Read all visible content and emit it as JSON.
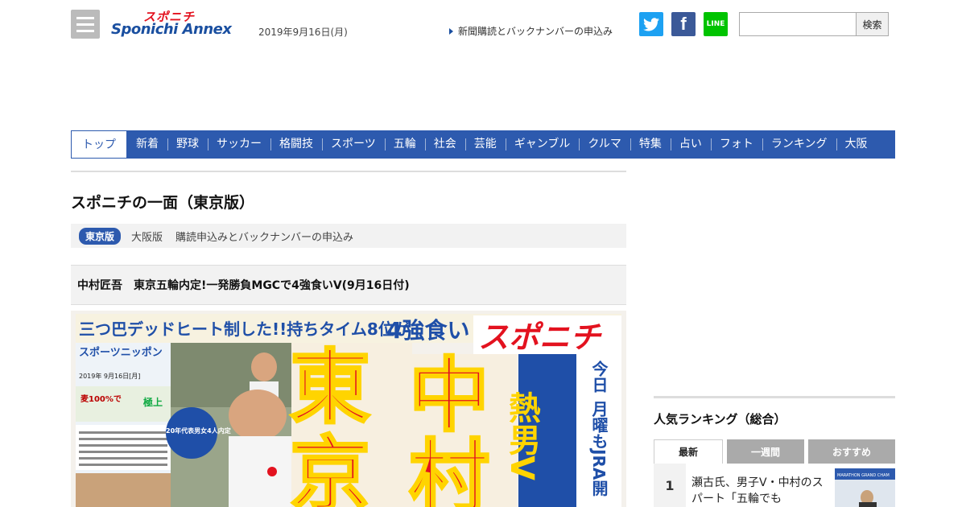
{
  "header": {
    "logo_top": "スポニチ",
    "logo_main": "Sponichi Annex",
    "date": "2019年9月16日(月)",
    "subscription_link": "新聞購読とバックナンバーの申込み",
    "social": {
      "twitter": "t",
      "facebook": "f",
      "line": "LINE"
    },
    "search_button": "検索",
    "search_value": ""
  },
  "nav": {
    "items": [
      "トップ",
      "新着",
      "野球",
      "サッカー",
      "格闘技",
      "スポーツ",
      "五輪",
      "社会",
      "芸能",
      "ギャンブル",
      "クルマ",
      "特集",
      "占い",
      "フォト",
      "ランキング",
      "大阪"
    ]
  },
  "main": {
    "page_title": "スポニチの一面（東京版）",
    "edition_badge": "東京版",
    "edition_osaka": "大阪版",
    "edition_subscribe": "購読申込みとバックナンバーの申込み",
    "headline": "中村匠吾　東京五輪内定!一発勝負MGCで4強食いV(9月16日付)"
  },
  "front_page": {
    "banner": "三つ巴デッドヒート制した!!持ちタイム8位が",
    "banner2": "4強食い",
    "masthead": "スポニチ",
    "paper_name": "スポーツニッポン",
    "paper_date": "2019年 9月16日[月]",
    "big_left": "東",
    "big_left2": "京",
    "big_right": "中",
    "big_right2": "村",
    "yellow_headline": "熱男V",
    "side_text_1": "今日",
    "side_text_2": "月曜もJRA開",
    "sticker": "20年代表男女4人内定",
    "ad_text": "麦100%で",
    "ad_brand": "極上"
  },
  "sidebar": {
    "ranking_title": "人気ランキング（総合）",
    "tabs": [
      "最新",
      "一週間",
      "おすすめ"
    ],
    "items": [
      {
        "rank": "1",
        "text": "瀬古氏、男子V・中村のスパート「五輪でも"
      }
    ],
    "thumb_caption": "MARATHON GRAND CHAM"
  }
}
